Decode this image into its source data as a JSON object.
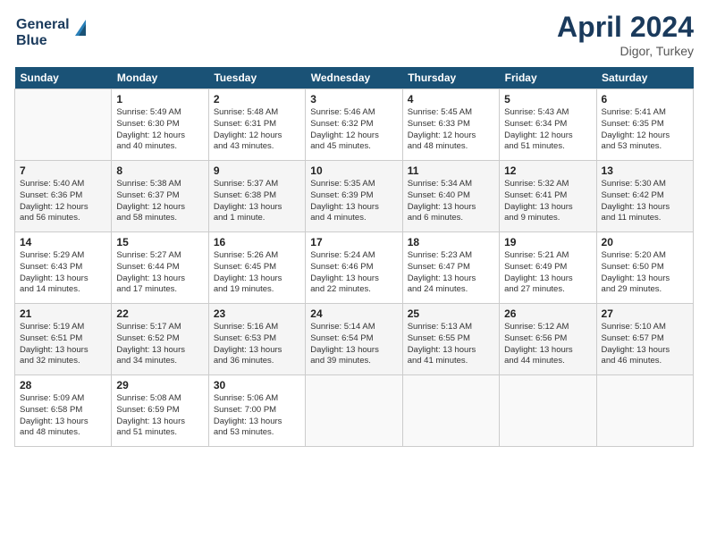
{
  "header": {
    "logo_line1": "General",
    "logo_line2": "Blue",
    "month": "April 2024",
    "location": "Digor, Turkey"
  },
  "days_of_week": [
    "Sunday",
    "Monday",
    "Tuesday",
    "Wednesday",
    "Thursday",
    "Friday",
    "Saturday"
  ],
  "weeks": [
    [
      {
        "day": "",
        "info": ""
      },
      {
        "day": "1",
        "info": "Sunrise: 5:49 AM\nSunset: 6:30 PM\nDaylight: 12 hours\nand 40 minutes."
      },
      {
        "day": "2",
        "info": "Sunrise: 5:48 AM\nSunset: 6:31 PM\nDaylight: 12 hours\nand 43 minutes."
      },
      {
        "day": "3",
        "info": "Sunrise: 5:46 AM\nSunset: 6:32 PM\nDaylight: 12 hours\nand 45 minutes."
      },
      {
        "day": "4",
        "info": "Sunrise: 5:45 AM\nSunset: 6:33 PM\nDaylight: 12 hours\nand 48 minutes."
      },
      {
        "day": "5",
        "info": "Sunrise: 5:43 AM\nSunset: 6:34 PM\nDaylight: 12 hours\nand 51 minutes."
      },
      {
        "day": "6",
        "info": "Sunrise: 5:41 AM\nSunset: 6:35 PM\nDaylight: 12 hours\nand 53 minutes."
      }
    ],
    [
      {
        "day": "7",
        "info": "Sunrise: 5:40 AM\nSunset: 6:36 PM\nDaylight: 12 hours\nand 56 minutes."
      },
      {
        "day": "8",
        "info": "Sunrise: 5:38 AM\nSunset: 6:37 PM\nDaylight: 12 hours\nand 58 minutes."
      },
      {
        "day": "9",
        "info": "Sunrise: 5:37 AM\nSunset: 6:38 PM\nDaylight: 13 hours\nand 1 minute."
      },
      {
        "day": "10",
        "info": "Sunrise: 5:35 AM\nSunset: 6:39 PM\nDaylight: 13 hours\nand 4 minutes."
      },
      {
        "day": "11",
        "info": "Sunrise: 5:34 AM\nSunset: 6:40 PM\nDaylight: 13 hours\nand 6 minutes."
      },
      {
        "day": "12",
        "info": "Sunrise: 5:32 AM\nSunset: 6:41 PM\nDaylight: 13 hours\nand 9 minutes."
      },
      {
        "day": "13",
        "info": "Sunrise: 5:30 AM\nSunset: 6:42 PM\nDaylight: 13 hours\nand 11 minutes."
      }
    ],
    [
      {
        "day": "14",
        "info": "Sunrise: 5:29 AM\nSunset: 6:43 PM\nDaylight: 13 hours\nand 14 minutes."
      },
      {
        "day": "15",
        "info": "Sunrise: 5:27 AM\nSunset: 6:44 PM\nDaylight: 13 hours\nand 17 minutes."
      },
      {
        "day": "16",
        "info": "Sunrise: 5:26 AM\nSunset: 6:45 PM\nDaylight: 13 hours\nand 19 minutes."
      },
      {
        "day": "17",
        "info": "Sunrise: 5:24 AM\nSunset: 6:46 PM\nDaylight: 13 hours\nand 22 minutes."
      },
      {
        "day": "18",
        "info": "Sunrise: 5:23 AM\nSunset: 6:47 PM\nDaylight: 13 hours\nand 24 minutes."
      },
      {
        "day": "19",
        "info": "Sunrise: 5:21 AM\nSunset: 6:49 PM\nDaylight: 13 hours\nand 27 minutes."
      },
      {
        "day": "20",
        "info": "Sunrise: 5:20 AM\nSunset: 6:50 PM\nDaylight: 13 hours\nand 29 minutes."
      }
    ],
    [
      {
        "day": "21",
        "info": "Sunrise: 5:19 AM\nSunset: 6:51 PM\nDaylight: 13 hours\nand 32 minutes."
      },
      {
        "day": "22",
        "info": "Sunrise: 5:17 AM\nSunset: 6:52 PM\nDaylight: 13 hours\nand 34 minutes."
      },
      {
        "day": "23",
        "info": "Sunrise: 5:16 AM\nSunset: 6:53 PM\nDaylight: 13 hours\nand 36 minutes."
      },
      {
        "day": "24",
        "info": "Sunrise: 5:14 AM\nSunset: 6:54 PM\nDaylight: 13 hours\nand 39 minutes."
      },
      {
        "day": "25",
        "info": "Sunrise: 5:13 AM\nSunset: 6:55 PM\nDaylight: 13 hours\nand 41 minutes."
      },
      {
        "day": "26",
        "info": "Sunrise: 5:12 AM\nSunset: 6:56 PM\nDaylight: 13 hours\nand 44 minutes."
      },
      {
        "day": "27",
        "info": "Sunrise: 5:10 AM\nSunset: 6:57 PM\nDaylight: 13 hours\nand 46 minutes."
      }
    ],
    [
      {
        "day": "28",
        "info": "Sunrise: 5:09 AM\nSunset: 6:58 PM\nDaylight: 13 hours\nand 48 minutes."
      },
      {
        "day": "29",
        "info": "Sunrise: 5:08 AM\nSunset: 6:59 PM\nDaylight: 13 hours\nand 51 minutes."
      },
      {
        "day": "30",
        "info": "Sunrise: 5:06 AM\nSunset: 7:00 PM\nDaylight: 13 hours\nand 53 minutes."
      },
      {
        "day": "",
        "info": ""
      },
      {
        "day": "",
        "info": ""
      },
      {
        "day": "",
        "info": ""
      },
      {
        "day": "",
        "info": ""
      }
    ]
  ]
}
